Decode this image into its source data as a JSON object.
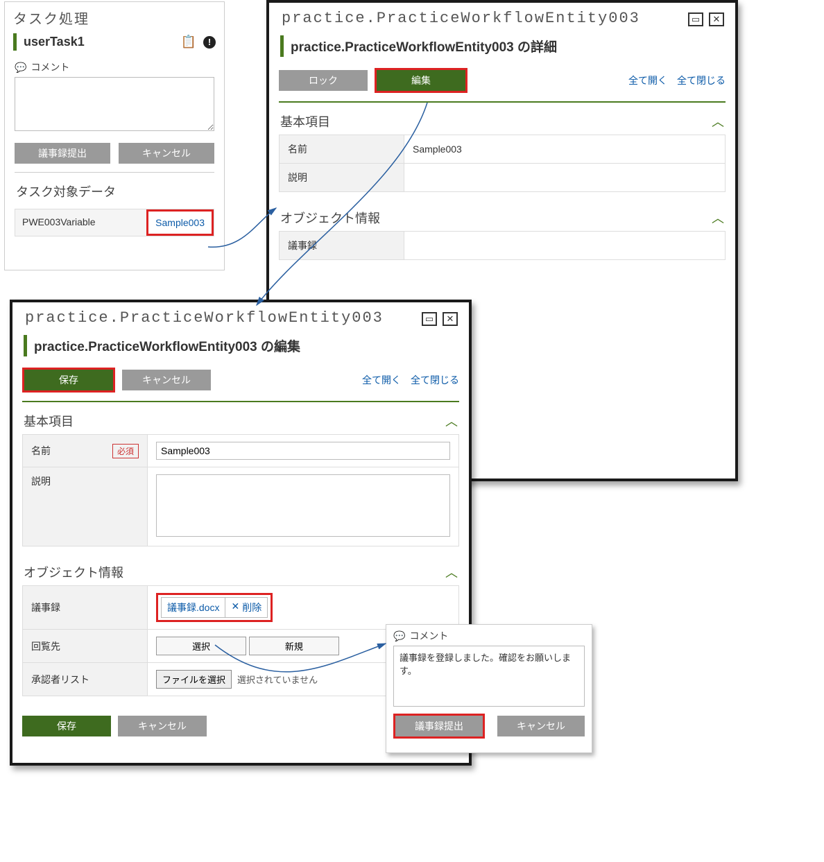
{
  "taskPanel": {
    "title": "タスク処理",
    "userTask": "userTask1",
    "commentLabel": "コメント",
    "submitBtn": "議事録提出",
    "cancelBtn": "キャンセル",
    "targetDataTitle": "タスク対象データ",
    "varName": "PWE003Variable",
    "varValue": "Sample003"
  },
  "detailPanel": {
    "header": "practice.PracticeWorkflowEntity003",
    "subtitle": "practice.PracticeWorkflowEntity003 の詳細",
    "lockBtn": "ロック",
    "editBtn": "編集",
    "expandAll": "全て開く",
    "collapseAll": "全て閉じる",
    "basicTitle": "基本項目",
    "nameLabel": "名前",
    "nameValue": "Sample003",
    "descLabel": "説明",
    "objTitle": "オブジェクト情報",
    "minutesLabel": "議事録"
  },
  "editPanel": {
    "header": "practice.PracticeWorkflowEntity003",
    "subtitle": "practice.PracticeWorkflowEntity003 の編集",
    "saveBtn": "保存",
    "cancelBtn": "キャンセル",
    "expandAll": "全て開く",
    "collapseAll": "全て閉じる",
    "basicTitle": "基本項目",
    "nameLabel": "名前",
    "required": "必須",
    "nameValue": "Sample003",
    "descLabel": "説明",
    "objTitle": "オブジェクト情報",
    "minutesLabel": "議事録",
    "minutesFile": "議事録.docx",
    "deleteLabel": "削除",
    "routeLabel": "回覧先",
    "selectBtn": "選択",
    "newBtn": "新規",
    "approverLabel": "承認者リスト",
    "fileSelectBtn": "ファイルを選択",
    "fileNone": "選択されていません",
    "saveBtn2": "保存",
    "cancelBtn2": "キャンセル"
  },
  "commentPopup": {
    "label": "コメント",
    "text": "議事録を登録しました。確認をお願いします。",
    "submitBtn": "議事録提出",
    "cancelBtn": "キャンセル"
  }
}
